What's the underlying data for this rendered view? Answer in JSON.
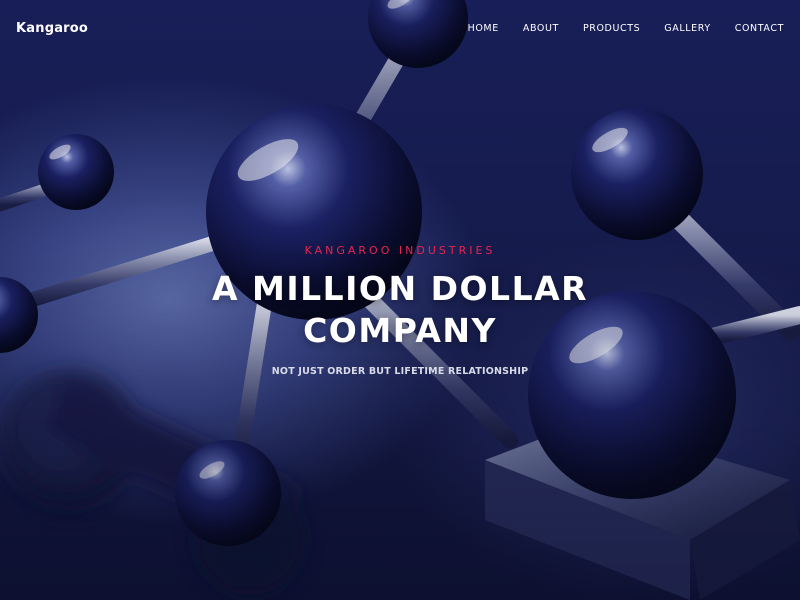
{
  "brand": {
    "name": "Kangaroo"
  },
  "nav": {
    "items": [
      {
        "label": "HOME"
      },
      {
        "label": "ABOUT"
      },
      {
        "label": "PRODUCTS"
      },
      {
        "label": "GALLERY"
      },
      {
        "label": "CONTACT"
      }
    ]
  },
  "hero": {
    "eyebrow": "KANGAROO INDUSTRIES",
    "headline_line1": "A MILLION DOLLAR",
    "headline_line2": "COMPANY",
    "tagline": "NOT JUST ORDER BUT LIFETIME RELATIONSHIP"
  },
  "colors": {
    "accent": "#e8254f",
    "background": "#10143a",
    "text": "#ffffff"
  }
}
